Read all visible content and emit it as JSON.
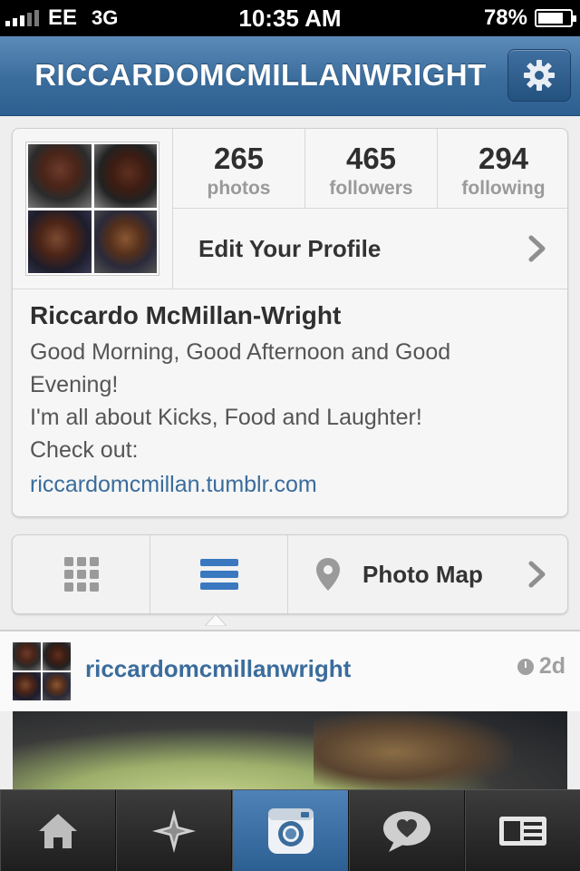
{
  "status_bar": {
    "carrier": "EE",
    "network": "3G",
    "time": "10:35 AM",
    "battery": "78%",
    "battery_level": 0.78
  },
  "nav": {
    "title": "RICCARDOMCMILLANWRIGHT"
  },
  "profile": {
    "stats": [
      {
        "value": "265",
        "label": "photos"
      },
      {
        "value": "465",
        "label": "followers"
      },
      {
        "value": "294",
        "label": "following"
      }
    ],
    "edit_label": "Edit Your Profile",
    "name": "Riccardo McMillan-Wright",
    "bio": [
      "Good Morning, Good Afternoon and Good",
      "Evening!",
      "I'm all about Kicks, Food and Laughter!",
      "Check out:"
    ],
    "link": "riccardomcmillan.tumblr.com"
  },
  "view_toggle": {
    "map_label": "Photo Map",
    "selected": "list"
  },
  "post": {
    "username": "riccardomcmillanwright",
    "age": "2d"
  },
  "tabs": [
    "home-icon",
    "explore-icon",
    "camera-icon",
    "news-icon",
    "profile-icon"
  ],
  "colors": {
    "accent": "#3a6c9c",
    "nav_bar": "#3a6c9c",
    "tab_active": "#2c5f92"
  }
}
